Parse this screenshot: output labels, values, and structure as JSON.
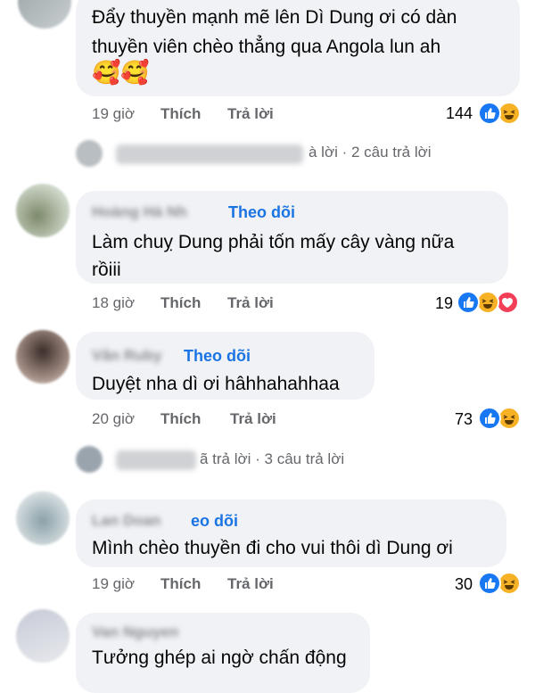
{
  "comments": [
    {
      "text_lines": [
        "Đẩy thuyền mạnh mẽ lên Dì Dung ơi có dàn",
        "thuyền viên chèo thẳng qua Angola lun ah"
      ],
      "emojis": "🥰🥰",
      "time": "19 giờ",
      "like_label": "Thích",
      "reply_label": "Trả lời",
      "reaction_count": "144",
      "reactions": [
        "like",
        "haha"
      ]
    },
    {
      "follow": "Theo dõi",
      "text_lines": [
        "Làm chuỵ Dung phải tốn mấy cây vàng nữa",
        "rồiii"
      ],
      "time": "18 giờ",
      "like_label": "Thích",
      "reply_label": "Trả lời",
      "reaction_count": "19",
      "reactions": [
        "like",
        "haha",
        "love"
      ]
    },
    {
      "follow": "Theo dõi",
      "text_lines": [
        "Duyệt nha dì ơi hâhhahahhaa"
      ],
      "time": "20 giờ",
      "like_label": "Thích",
      "reply_label": "Trả lời",
      "reaction_count": "73",
      "reactions": [
        "like",
        "haha"
      ]
    },
    {
      "follow": "eo dõi",
      "text_lines": [
        "Mình chèo thuyền đi cho vui thôi dì Dung ơi"
      ],
      "time": "19 giờ",
      "like_label": "Thích",
      "reply_label": "Trả lời",
      "reaction_count": "30",
      "reactions": [
        "like",
        "haha"
      ]
    },
    {
      "text_lines": [
        "Tưởng ghép ai ngờ chấn động"
      ]
    }
  ],
  "replies": [
    {
      "text": "à lời · 2 câu trả lời"
    },
    {
      "text": "ã trả lời · 3 câu trả lời"
    }
  ],
  "colors": {
    "bubble": "#f0f2f5",
    "link": "#1b74e4",
    "meta": "#65676b",
    "like": "#1877f2",
    "haha": "#f7b125",
    "love": "#f33e58"
  }
}
